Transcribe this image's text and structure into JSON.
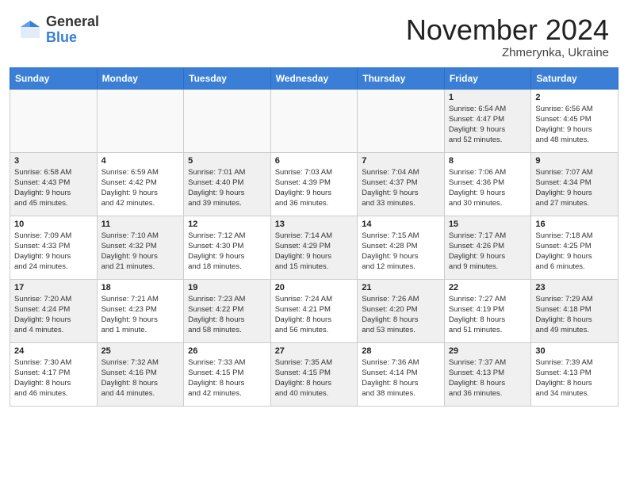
{
  "header": {
    "logo_general": "General",
    "logo_blue": "Blue",
    "month_title": "November 2024",
    "location": "Zhmerynka, Ukraine"
  },
  "weekdays": [
    "Sunday",
    "Monday",
    "Tuesday",
    "Wednesday",
    "Thursday",
    "Friday",
    "Saturday"
  ],
  "weeks": [
    [
      {
        "day": "",
        "info": "",
        "empty": true
      },
      {
        "day": "",
        "info": "",
        "empty": true
      },
      {
        "day": "",
        "info": "",
        "empty": true
      },
      {
        "day": "",
        "info": "",
        "empty": true
      },
      {
        "day": "",
        "info": "",
        "empty": true
      },
      {
        "day": "1",
        "info": "Sunrise: 6:54 AM\nSunset: 4:47 PM\nDaylight: 9 hours\nand 52 minutes.",
        "shaded": true
      },
      {
        "day": "2",
        "info": "Sunrise: 6:56 AM\nSunset: 4:45 PM\nDaylight: 9 hours\nand 48 minutes.",
        "shaded": false
      }
    ],
    [
      {
        "day": "3",
        "info": "Sunrise: 6:58 AM\nSunset: 4:43 PM\nDaylight: 9 hours\nand 45 minutes.",
        "shaded": true
      },
      {
        "day": "4",
        "info": "Sunrise: 6:59 AM\nSunset: 4:42 PM\nDaylight: 9 hours\nand 42 minutes.",
        "shaded": false
      },
      {
        "day": "5",
        "info": "Sunrise: 7:01 AM\nSunset: 4:40 PM\nDaylight: 9 hours\nand 39 minutes.",
        "shaded": true
      },
      {
        "day": "6",
        "info": "Sunrise: 7:03 AM\nSunset: 4:39 PM\nDaylight: 9 hours\nand 36 minutes.",
        "shaded": false
      },
      {
        "day": "7",
        "info": "Sunrise: 7:04 AM\nSunset: 4:37 PM\nDaylight: 9 hours\nand 33 minutes.",
        "shaded": true
      },
      {
        "day": "8",
        "info": "Sunrise: 7:06 AM\nSunset: 4:36 PM\nDaylight: 9 hours\nand 30 minutes.",
        "shaded": false
      },
      {
        "day": "9",
        "info": "Sunrise: 7:07 AM\nSunset: 4:34 PM\nDaylight: 9 hours\nand 27 minutes.",
        "shaded": true
      }
    ],
    [
      {
        "day": "10",
        "info": "Sunrise: 7:09 AM\nSunset: 4:33 PM\nDaylight: 9 hours\nand 24 minutes.",
        "shaded": false
      },
      {
        "day": "11",
        "info": "Sunrise: 7:10 AM\nSunset: 4:32 PM\nDaylight: 9 hours\nand 21 minutes.",
        "shaded": true
      },
      {
        "day": "12",
        "info": "Sunrise: 7:12 AM\nSunset: 4:30 PM\nDaylight: 9 hours\nand 18 minutes.",
        "shaded": false
      },
      {
        "day": "13",
        "info": "Sunrise: 7:14 AM\nSunset: 4:29 PM\nDaylight: 9 hours\nand 15 minutes.",
        "shaded": true
      },
      {
        "day": "14",
        "info": "Sunrise: 7:15 AM\nSunset: 4:28 PM\nDaylight: 9 hours\nand 12 minutes.",
        "shaded": false
      },
      {
        "day": "15",
        "info": "Sunrise: 7:17 AM\nSunset: 4:26 PM\nDaylight: 9 hours\nand 9 minutes.",
        "shaded": true
      },
      {
        "day": "16",
        "info": "Sunrise: 7:18 AM\nSunset: 4:25 PM\nDaylight: 9 hours\nand 6 minutes.",
        "shaded": false
      }
    ],
    [
      {
        "day": "17",
        "info": "Sunrise: 7:20 AM\nSunset: 4:24 PM\nDaylight: 9 hours\nand 4 minutes.",
        "shaded": true
      },
      {
        "day": "18",
        "info": "Sunrise: 7:21 AM\nSunset: 4:23 PM\nDaylight: 9 hours\nand 1 minute.",
        "shaded": false
      },
      {
        "day": "19",
        "info": "Sunrise: 7:23 AM\nSunset: 4:22 PM\nDaylight: 8 hours\nand 58 minutes.",
        "shaded": true
      },
      {
        "day": "20",
        "info": "Sunrise: 7:24 AM\nSunset: 4:21 PM\nDaylight: 8 hours\nand 56 minutes.",
        "shaded": false
      },
      {
        "day": "21",
        "info": "Sunrise: 7:26 AM\nSunset: 4:20 PM\nDaylight: 8 hours\nand 53 minutes.",
        "shaded": true
      },
      {
        "day": "22",
        "info": "Sunrise: 7:27 AM\nSunset: 4:19 PM\nDaylight: 8 hours\nand 51 minutes.",
        "shaded": false
      },
      {
        "day": "23",
        "info": "Sunrise: 7:29 AM\nSunset: 4:18 PM\nDaylight: 8 hours\nand 49 minutes.",
        "shaded": true
      }
    ],
    [
      {
        "day": "24",
        "info": "Sunrise: 7:30 AM\nSunset: 4:17 PM\nDaylight: 8 hours\nand 46 minutes.",
        "shaded": false
      },
      {
        "day": "25",
        "info": "Sunrise: 7:32 AM\nSunset: 4:16 PM\nDaylight: 8 hours\nand 44 minutes.",
        "shaded": true
      },
      {
        "day": "26",
        "info": "Sunrise: 7:33 AM\nSunset: 4:15 PM\nDaylight: 8 hours\nand 42 minutes.",
        "shaded": false
      },
      {
        "day": "27",
        "info": "Sunrise: 7:35 AM\nSunset: 4:15 PM\nDaylight: 8 hours\nand 40 minutes.",
        "shaded": true
      },
      {
        "day": "28",
        "info": "Sunrise: 7:36 AM\nSunset: 4:14 PM\nDaylight: 8 hours\nand 38 minutes.",
        "shaded": false
      },
      {
        "day": "29",
        "info": "Sunrise: 7:37 AM\nSunset: 4:13 PM\nDaylight: 8 hours\nand 36 minutes.",
        "shaded": true
      },
      {
        "day": "30",
        "info": "Sunrise: 7:39 AM\nSunset: 4:13 PM\nDaylight: 8 hours\nand 34 minutes.",
        "shaded": false
      }
    ]
  ]
}
